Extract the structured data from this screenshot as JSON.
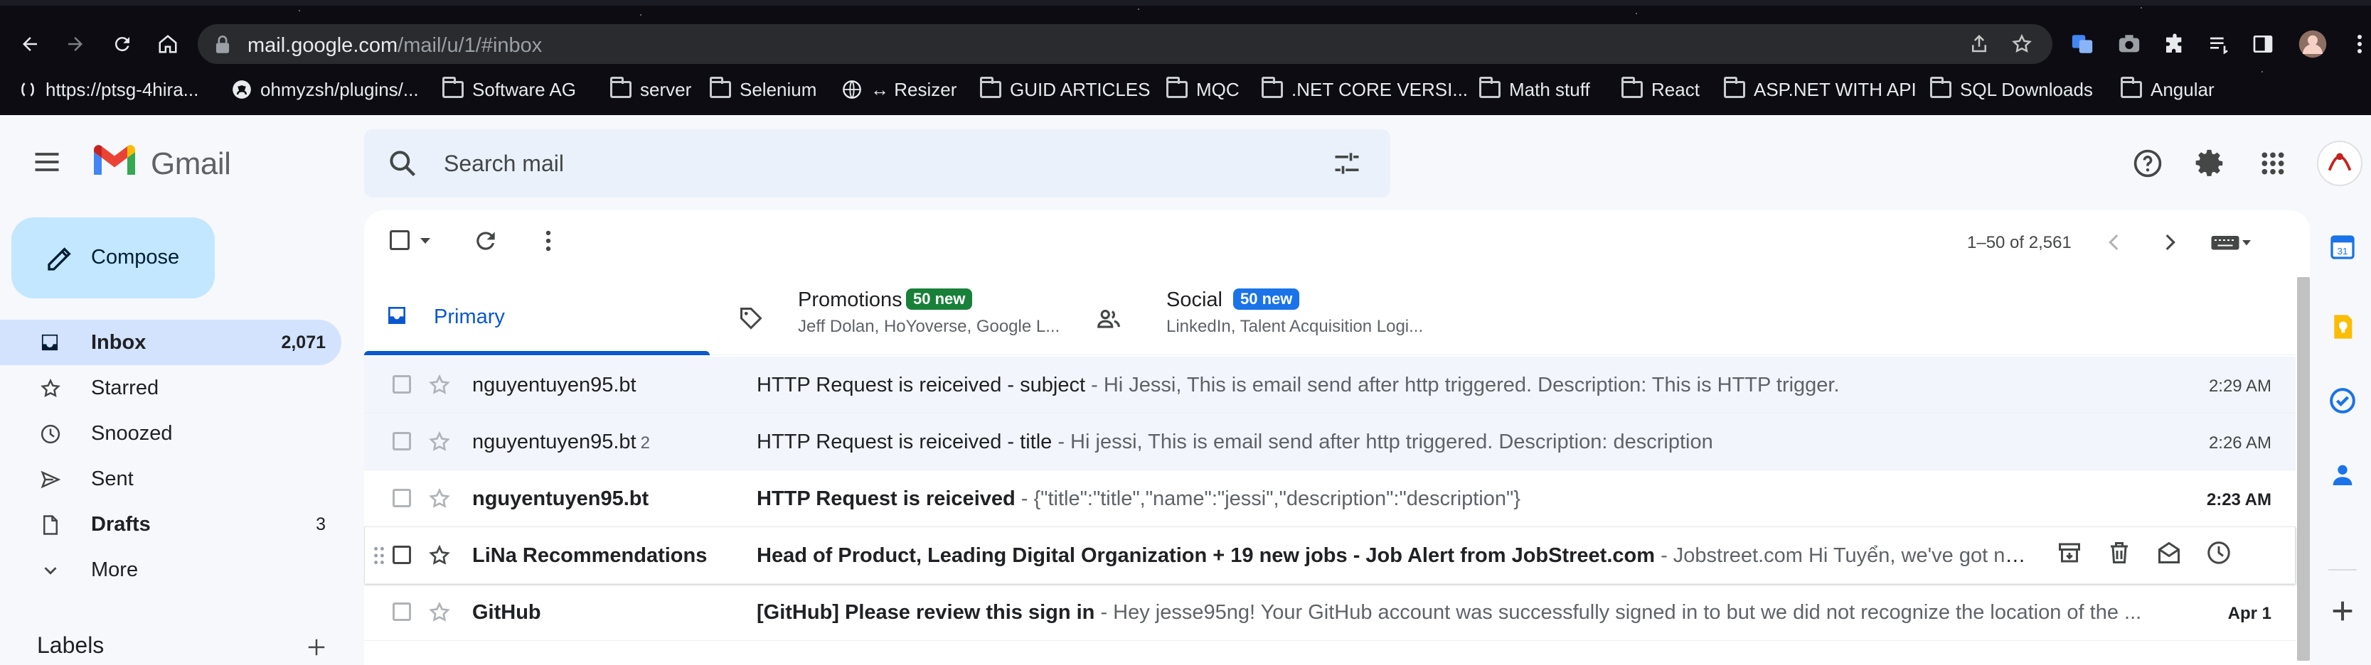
{
  "browser": {
    "url_host": "mail.google.com",
    "url_path": "/mail/u/1/#inbox",
    "bookmarks": [
      {
        "label": "https://ptsg-4hira...",
        "icon": "link-icon"
      },
      {
        "label": "ohmyzsh/plugins/...",
        "icon": "github-icon"
      },
      {
        "label": "Software AG",
        "icon": "folder-icon"
      },
      {
        "label": "server",
        "icon": "folder-icon"
      },
      {
        "label": "Selenium",
        "icon": "folder-icon"
      },
      {
        "label": "↔ Resizer",
        "icon": "globe-icon"
      },
      {
        "label": "GUID ARTICLES",
        "icon": "folder-icon"
      },
      {
        "label": "MQC",
        "icon": "folder-icon"
      },
      {
        "label": ".NET CORE VERSI...",
        "icon": "folder-icon"
      },
      {
        "label": "Math stuff",
        "icon": "folder-icon"
      },
      {
        "label": "React",
        "icon": "folder-icon"
      },
      {
        "label": "ASP.NET WITH API",
        "icon": "folder-icon"
      },
      {
        "label": "SQL Downloads",
        "icon": "folder-icon"
      },
      {
        "label": "Angular",
        "icon": "folder-icon"
      }
    ]
  },
  "gmail": {
    "brand": "Gmail",
    "search_placeholder": "Search mail",
    "compose_label": "Compose",
    "nav": [
      {
        "label": "Inbox",
        "count": "2,071",
        "icon": "inbox-icon"
      },
      {
        "label": "Starred",
        "count": "",
        "icon": "star-icon"
      },
      {
        "label": "Snoozed",
        "count": "",
        "icon": "clock-icon"
      },
      {
        "label": "Sent",
        "count": "",
        "icon": "send-icon"
      },
      {
        "label": "Drafts",
        "count": "3",
        "icon": "draft-icon"
      },
      {
        "label": "More",
        "count": "",
        "icon": "chevron-down-icon"
      }
    ],
    "labels_title": "Labels",
    "pagination": "1–50 of 2,561",
    "tabs": {
      "primary": {
        "label": "Primary"
      },
      "promotions": {
        "label": "Promotions",
        "badge": "50 new",
        "subtitle": "Jeff Dolan, HoYoverse, Google L..."
      },
      "social": {
        "label": "Social",
        "badge": "50 new",
        "subtitle": "LinkedIn, Talent Acquisition Logi..."
      }
    },
    "emails": [
      {
        "sender": "nguyentuyen95.bt",
        "count": "",
        "subject": "HTTP Request is reiceived - subject",
        "snippet": " - Hi Jessi, This is email send after http triggered. Description: This is HTTP trigger.",
        "date": "2:29 AM"
      },
      {
        "sender": "nguyentuyen95.bt",
        "count": "2",
        "subject": "HTTP Request is reiceived - title",
        "snippet": " - Hi jessi, This is email send after http triggered. Description: description",
        "date": "2:26 AM"
      },
      {
        "sender": "nguyentuyen95.bt",
        "count": "",
        "subject": "HTTP Request is reiceived",
        "snippet": " - {\"title\":\"title\",\"name\":\"jessi\",\"description\":\"description\"}",
        "date": "2:23 AM"
      },
      {
        "sender": "LiNa Recommendations",
        "count": "",
        "subject": "Head of Product, Leading Digital Organization + 19 new jobs - Job Alert from JobStreet.com",
        "snippet": " - Jobstreet.com Hi Tuyển, we've got new j...",
        "date": ""
      },
      {
        "sender": "GitHub",
        "count": "",
        "subject": "[GitHub] Please review this sign in",
        "snippet": " - Hey jesse95ng! Your GitHub account was successfully signed in to but we did not recognize the location of the ...",
        "date": "Apr 1"
      }
    ],
    "colors": {
      "accent": "#0b57d0",
      "compose": "#c2e7ff",
      "active_nav": "#d3e3fd",
      "promotions_badge": "#188038",
      "social_badge": "#1a73e8"
    }
  }
}
